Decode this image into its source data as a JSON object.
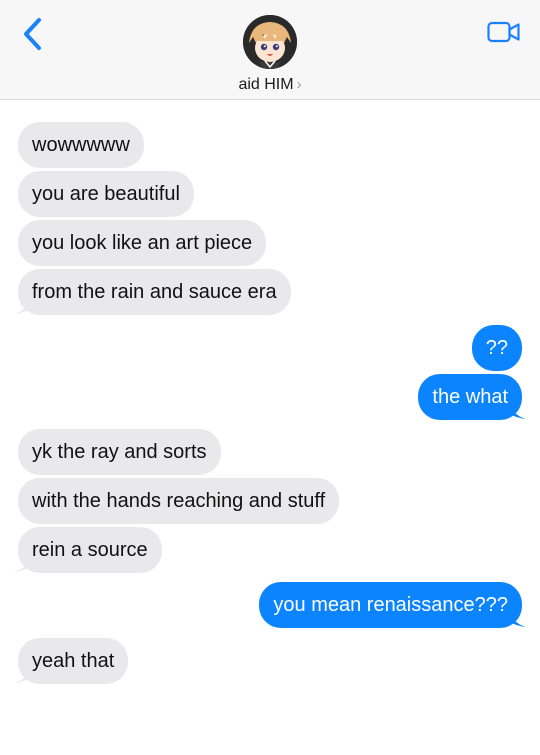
{
  "header": {
    "contact_name": "aid HIM",
    "back_icon": "chevron-left-icon",
    "video_icon": "video-camera-icon"
  },
  "colors": {
    "incoming_bubble": "#e9e9eb",
    "outgoing_bubble": "#0b84fe",
    "accent": "#1a82fb"
  },
  "messages": [
    {
      "from": "them",
      "text": "wowwwww"
    },
    {
      "from": "them",
      "text": "you are beautiful"
    },
    {
      "from": "them",
      "text": "you look like an art piece"
    },
    {
      "from": "them",
      "text": "from the rain and sauce era"
    },
    {
      "from": "me",
      "text": "??"
    },
    {
      "from": "me",
      "text": "the what"
    },
    {
      "from": "them",
      "text": "yk the ray and sorts"
    },
    {
      "from": "them",
      "text": "with the hands reaching and stuff"
    },
    {
      "from": "them",
      "text": "rein a source"
    },
    {
      "from": "me",
      "text": "you mean renaissance???"
    },
    {
      "from": "them",
      "text": "yeah that"
    }
  ]
}
